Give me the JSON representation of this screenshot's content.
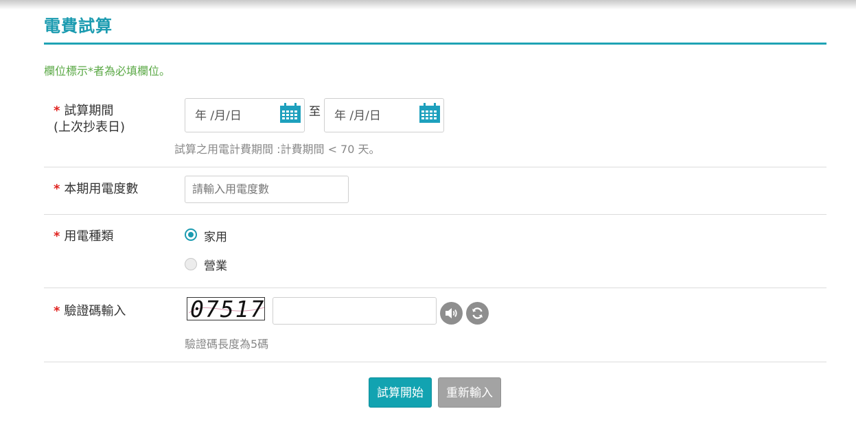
{
  "page": {
    "title": "電費試算",
    "required_note": "欄位標示*者為必填欄位。"
  },
  "period": {
    "label": "試算期間",
    "sublabel": "(上次抄表日)",
    "start_placeholder": "年 /月/日",
    "separator": "至",
    "end_placeholder": "年 /月/日",
    "hint": "試算之用電計費期間 :計費期間 < 70 天。"
  },
  "usage": {
    "label": "本期用電度數",
    "placeholder": "請輸入用電度數"
  },
  "type": {
    "label": "用電種類",
    "options": [
      {
        "label": "家用",
        "selected": true
      },
      {
        "label": "營業",
        "selected": false
      }
    ]
  },
  "captcha": {
    "label": "驗證碼輸入",
    "image_text": "07517",
    "hint": "驗證碼長度為5碼"
  },
  "buttons": {
    "submit": "試算開始",
    "reset": "重新輸入"
  },
  "colors": {
    "accent": "#1b9bb0",
    "note_green": "#5aa845",
    "required_red": "#e0231f"
  }
}
